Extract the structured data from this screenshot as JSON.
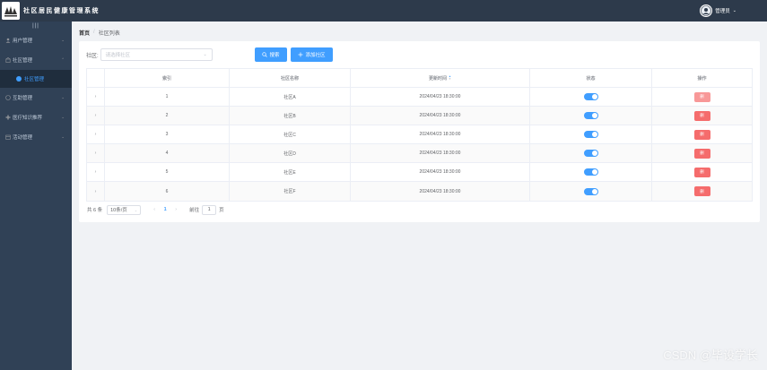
{
  "header": {
    "title": "社区居民健康管理系统",
    "user_name": "管理员",
    "user_caret": "⌄"
  },
  "sidebar": {
    "collapse_icon": "|||",
    "items": [
      {
        "label": "用户管理",
        "icon": "user-icon",
        "arrow": "⌄"
      },
      {
        "label": "社区管理",
        "icon": "community-icon",
        "arrow": "⌃"
      },
      {
        "label": "社区管理",
        "icon": "dot-icon",
        "sub": true
      },
      {
        "label": "互助管理",
        "icon": "help-icon",
        "arrow": "⌄"
      },
      {
        "label": "医疗知识推荐",
        "icon": "medical-icon",
        "arrow": "⌄"
      },
      {
        "label": "活动管理",
        "icon": "activity-icon",
        "arrow": "⌄"
      }
    ]
  },
  "breadcrumb": {
    "home": "首页",
    "separator": "/",
    "current": "社区列表"
  },
  "filter": {
    "label": "社区:",
    "placeholder": "请选择社区",
    "caret": "⌄"
  },
  "buttons": {
    "search": "搜索",
    "add": "添加社区"
  },
  "table": {
    "headers": {
      "index": "索引",
      "name": "社区名称",
      "time": "更新时间",
      "status": "状态",
      "op": "操作"
    },
    "expand_glyph": "›",
    "delete_label": "删",
    "rows": [
      {
        "index": "1",
        "name": "社区A",
        "time": "2024/04/23 18:30:00",
        "status": true
      },
      {
        "index": "2",
        "name": "社区B",
        "time": "2024/04/23 18:30:00",
        "status": true
      },
      {
        "index": "3",
        "name": "社区C",
        "time": "2024/04/23 18:30:00",
        "status": true
      },
      {
        "index": "4",
        "name": "社区D",
        "time": "2024/04/23 18:30:00",
        "status": true
      },
      {
        "index": "5",
        "name": "社区E",
        "time": "2024/04/23 18:30:00",
        "status": true
      },
      {
        "index": "6",
        "name": "社区F",
        "time": "2024/04/23 18:30:00",
        "status": true
      }
    ]
  },
  "pagination": {
    "total": "共 6 条",
    "page_size": "10条/页",
    "prev": "‹",
    "current_page": "1",
    "next": "›",
    "goto_label": "前往",
    "goto_value": "1",
    "page_unit": "页"
  },
  "watermark": "CSDN @毕设学长",
  "colors": {
    "header_bg": "#2d3a4b",
    "sidebar_bg": "#304156",
    "primary": "#409eff",
    "danger": "#f56c6c"
  }
}
